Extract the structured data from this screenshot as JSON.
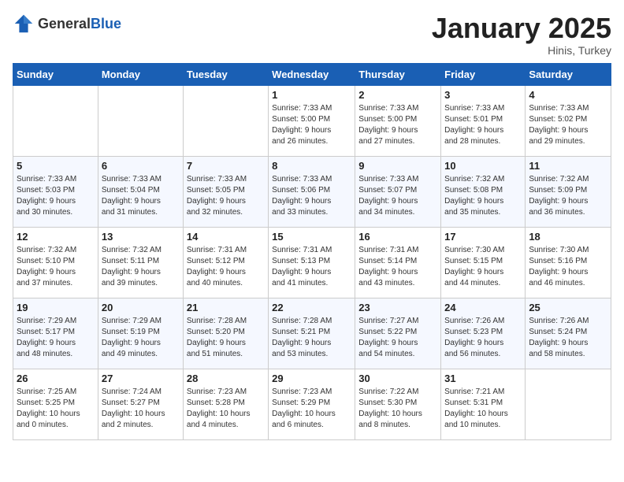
{
  "logo": {
    "text_general": "General",
    "text_blue": "Blue"
  },
  "calendar": {
    "title": "January 2025",
    "subtitle": "Hinis, Turkey"
  },
  "days_of_week": [
    "Sunday",
    "Monday",
    "Tuesday",
    "Wednesday",
    "Thursday",
    "Friday",
    "Saturday"
  ],
  "weeks": [
    [
      {
        "day": "",
        "detail": ""
      },
      {
        "day": "",
        "detail": ""
      },
      {
        "day": "",
        "detail": ""
      },
      {
        "day": "1",
        "detail": "Sunrise: 7:33 AM\nSunset: 5:00 PM\nDaylight: 9 hours\nand 26 minutes."
      },
      {
        "day": "2",
        "detail": "Sunrise: 7:33 AM\nSunset: 5:00 PM\nDaylight: 9 hours\nand 27 minutes."
      },
      {
        "day": "3",
        "detail": "Sunrise: 7:33 AM\nSunset: 5:01 PM\nDaylight: 9 hours\nand 28 minutes."
      },
      {
        "day": "4",
        "detail": "Sunrise: 7:33 AM\nSunset: 5:02 PM\nDaylight: 9 hours\nand 29 minutes."
      }
    ],
    [
      {
        "day": "5",
        "detail": "Sunrise: 7:33 AM\nSunset: 5:03 PM\nDaylight: 9 hours\nand 30 minutes."
      },
      {
        "day": "6",
        "detail": "Sunrise: 7:33 AM\nSunset: 5:04 PM\nDaylight: 9 hours\nand 31 minutes."
      },
      {
        "day": "7",
        "detail": "Sunrise: 7:33 AM\nSunset: 5:05 PM\nDaylight: 9 hours\nand 32 minutes."
      },
      {
        "day": "8",
        "detail": "Sunrise: 7:33 AM\nSunset: 5:06 PM\nDaylight: 9 hours\nand 33 minutes."
      },
      {
        "day": "9",
        "detail": "Sunrise: 7:33 AM\nSunset: 5:07 PM\nDaylight: 9 hours\nand 34 minutes."
      },
      {
        "day": "10",
        "detail": "Sunrise: 7:32 AM\nSunset: 5:08 PM\nDaylight: 9 hours\nand 35 minutes."
      },
      {
        "day": "11",
        "detail": "Sunrise: 7:32 AM\nSunset: 5:09 PM\nDaylight: 9 hours\nand 36 minutes."
      }
    ],
    [
      {
        "day": "12",
        "detail": "Sunrise: 7:32 AM\nSunset: 5:10 PM\nDaylight: 9 hours\nand 37 minutes."
      },
      {
        "day": "13",
        "detail": "Sunrise: 7:32 AM\nSunset: 5:11 PM\nDaylight: 9 hours\nand 39 minutes."
      },
      {
        "day": "14",
        "detail": "Sunrise: 7:31 AM\nSunset: 5:12 PM\nDaylight: 9 hours\nand 40 minutes."
      },
      {
        "day": "15",
        "detail": "Sunrise: 7:31 AM\nSunset: 5:13 PM\nDaylight: 9 hours\nand 41 minutes."
      },
      {
        "day": "16",
        "detail": "Sunrise: 7:31 AM\nSunset: 5:14 PM\nDaylight: 9 hours\nand 43 minutes."
      },
      {
        "day": "17",
        "detail": "Sunrise: 7:30 AM\nSunset: 5:15 PM\nDaylight: 9 hours\nand 44 minutes."
      },
      {
        "day": "18",
        "detail": "Sunrise: 7:30 AM\nSunset: 5:16 PM\nDaylight: 9 hours\nand 46 minutes."
      }
    ],
    [
      {
        "day": "19",
        "detail": "Sunrise: 7:29 AM\nSunset: 5:17 PM\nDaylight: 9 hours\nand 48 minutes."
      },
      {
        "day": "20",
        "detail": "Sunrise: 7:29 AM\nSunset: 5:19 PM\nDaylight: 9 hours\nand 49 minutes."
      },
      {
        "day": "21",
        "detail": "Sunrise: 7:28 AM\nSunset: 5:20 PM\nDaylight: 9 hours\nand 51 minutes."
      },
      {
        "day": "22",
        "detail": "Sunrise: 7:28 AM\nSunset: 5:21 PM\nDaylight: 9 hours\nand 53 minutes."
      },
      {
        "day": "23",
        "detail": "Sunrise: 7:27 AM\nSunset: 5:22 PM\nDaylight: 9 hours\nand 54 minutes."
      },
      {
        "day": "24",
        "detail": "Sunrise: 7:26 AM\nSunset: 5:23 PM\nDaylight: 9 hours\nand 56 minutes."
      },
      {
        "day": "25",
        "detail": "Sunrise: 7:26 AM\nSunset: 5:24 PM\nDaylight: 9 hours\nand 58 minutes."
      }
    ],
    [
      {
        "day": "26",
        "detail": "Sunrise: 7:25 AM\nSunset: 5:25 PM\nDaylight: 10 hours\nand 0 minutes."
      },
      {
        "day": "27",
        "detail": "Sunrise: 7:24 AM\nSunset: 5:27 PM\nDaylight: 10 hours\nand 2 minutes."
      },
      {
        "day": "28",
        "detail": "Sunrise: 7:23 AM\nSunset: 5:28 PM\nDaylight: 10 hours\nand 4 minutes."
      },
      {
        "day": "29",
        "detail": "Sunrise: 7:23 AM\nSunset: 5:29 PM\nDaylight: 10 hours\nand 6 minutes."
      },
      {
        "day": "30",
        "detail": "Sunrise: 7:22 AM\nSunset: 5:30 PM\nDaylight: 10 hours\nand 8 minutes."
      },
      {
        "day": "31",
        "detail": "Sunrise: 7:21 AM\nSunset: 5:31 PM\nDaylight: 10 hours\nand 10 minutes."
      },
      {
        "day": "",
        "detail": ""
      }
    ]
  ]
}
